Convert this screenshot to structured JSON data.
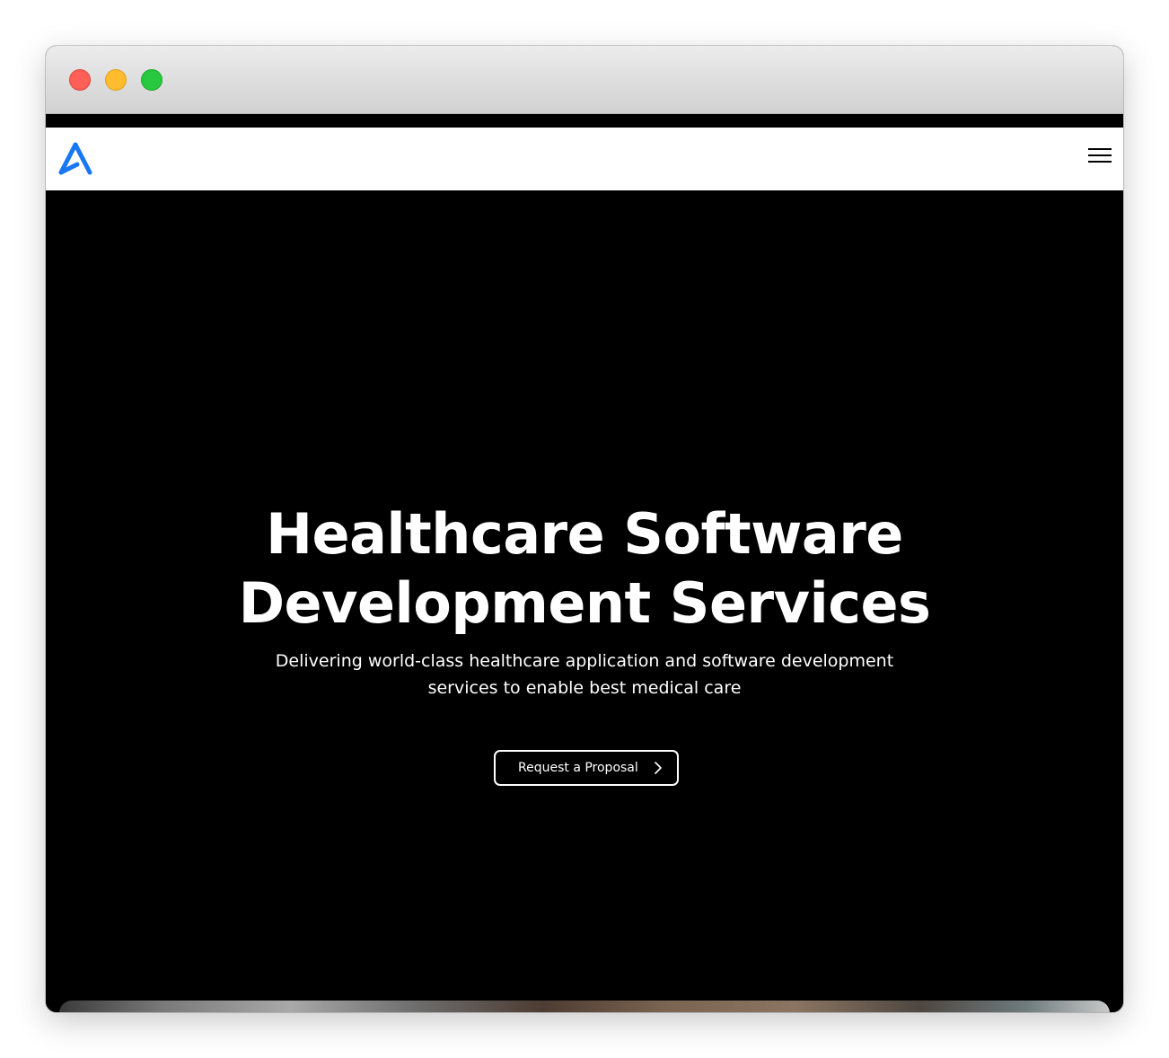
{
  "window": {
    "controls": [
      "close",
      "minimize",
      "zoom"
    ]
  },
  "navbar": {
    "logo_icon": "brand-logo-icon",
    "menu_icon": "hamburger-menu-icon",
    "brand_color": "#1877f2"
  },
  "hero": {
    "title_line1": "Healthcare Software",
    "title_line2": "Development Services",
    "subtitle_line1": "Delivering world-class healthcare application and software development",
    "subtitle_line2": "services to enable best medical care",
    "cta_label": "Request a Proposal",
    "cta_icon": "chevron-right-icon",
    "background": "#000000",
    "text_color": "#ffffff"
  }
}
